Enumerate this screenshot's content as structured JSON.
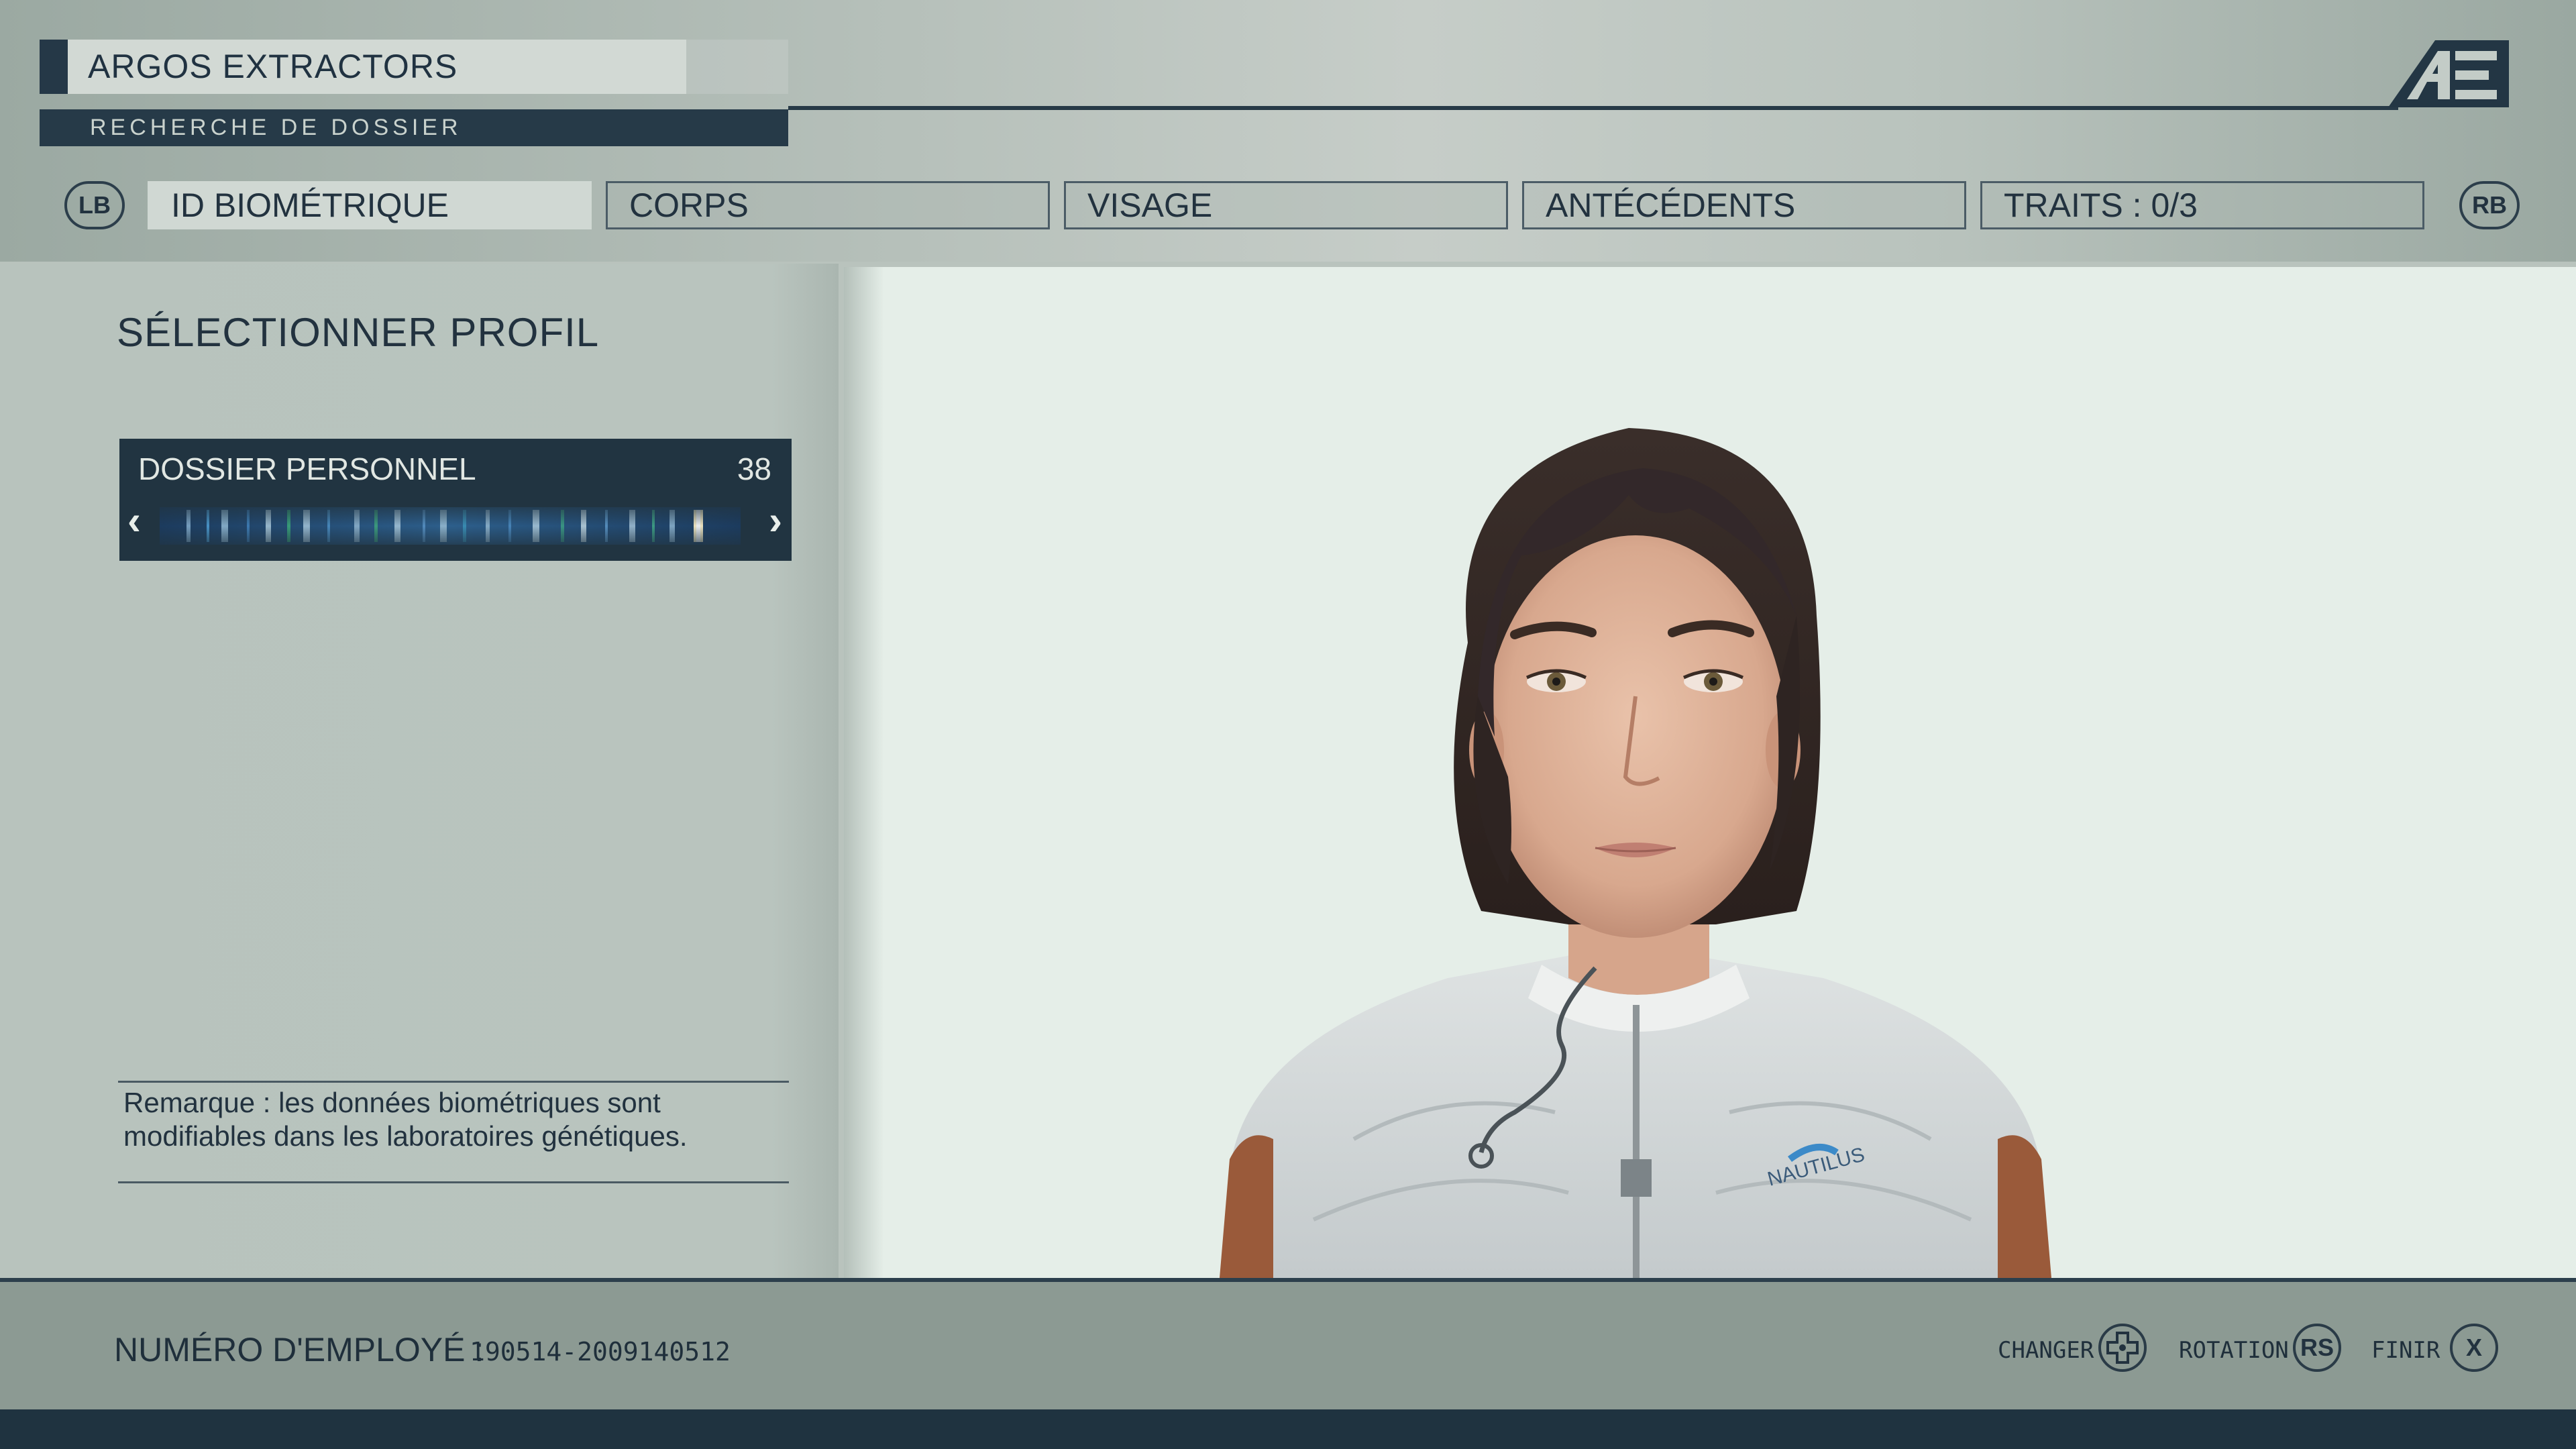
{
  "header": {
    "company": "ARGOS EXTRACTORS",
    "subtitle": "RECHERCHE DE DOSSIER",
    "logo": "ae-logo"
  },
  "tabs": {
    "left_bumper": "LB",
    "right_bumper": "RB",
    "items": [
      {
        "label": "ID BIOMÉTRIQUE",
        "active": true
      },
      {
        "label": "CORPS",
        "active": false
      },
      {
        "label": "VISAGE",
        "active": false
      },
      {
        "label": "ANTÉCÉDENTS",
        "active": false
      },
      {
        "label": "TRAITS : 0/3",
        "active": false
      }
    ]
  },
  "panel": {
    "heading": "SÉLECTIONNER PROFIL",
    "profile_label": "DOSSIER PERSONNEL",
    "profile_value": "38",
    "prev_icon": "chevron-left-icon",
    "next_icon": "chevron-right-icon",
    "note": "Remarque : les données biométriques sont modifiables dans les laboratoires génétiques."
  },
  "footer": {
    "employee_label": "NUMÉRO D'EMPLOYÉ :",
    "employee_number": "190514-2009140512",
    "hints": [
      {
        "label": "CHANGER",
        "button": "✚",
        "icon": "dpad-icon"
      },
      {
        "label": "ROTATION",
        "button": "RS",
        "icon": "right-stick-icon"
      },
      {
        "label": "FINIR",
        "button": "X",
        "icon": "x-button-icon"
      }
    ]
  },
  "colors": {
    "dark_navy": "#213441",
    "panel_bg": "#b9c4be",
    "viewport_bg": "#e5eee8",
    "footer_bg": "#8c9a93"
  }
}
